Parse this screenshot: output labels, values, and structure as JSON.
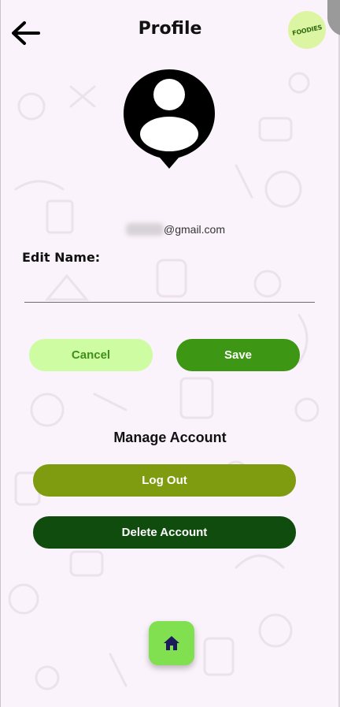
{
  "header": {
    "title": "Profile",
    "back_icon": "arrow-left-icon",
    "logo_text": "FOODIES"
  },
  "profile": {
    "avatar_icon": "user-location-pin-icon",
    "email_visible": "@gmail.com"
  },
  "edit": {
    "label": "Edit Name:",
    "name_value": "",
    "name_placeholder": ""
  },
  "actions": {
    "cancel_label": "Cancel",
    "save_label": "Save"
  },
  "manage": {
    "heading": "Manage Account",
    "logout_label": "Log Out",
    "delete_label": "Delete Account"
  },
  "bottom_nav": {
    "home_icon": "home-icon"
  },
  "colors": {
    "background": "#fbf3fb",
    "cancel_bg": "#cdfca3",
    "cancel_text": "#3f8f1a",
    "save_bg": "#3d9614",
    "logout_bg": "#7f9c10",
    "delete_bg": "#0f4c0e",
    "home_bg": "#80e04f",
    "home_icon": "#1d1a5e"
  }
}
